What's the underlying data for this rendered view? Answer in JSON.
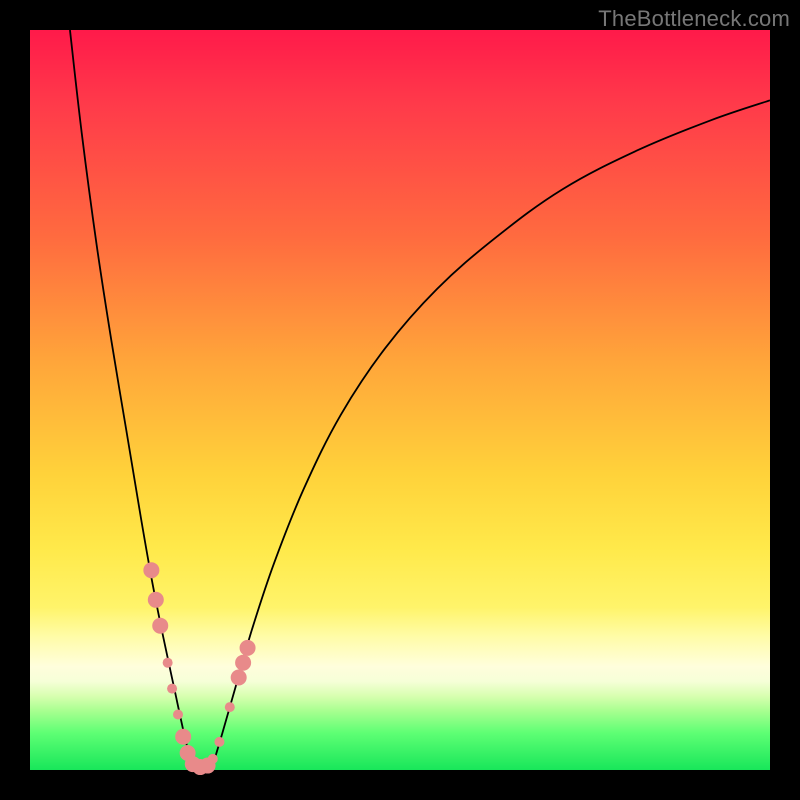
{
  "watermark": "TheBottleneck.com",
  "chart_data": {
    "type": "line",
    "title": "",
    "xlabel": "",
    "ylabel": "",
    "xlim": [
      0,
      100
    ],
    "ylim": [
      0,
      100
    ],
    "grid": false,
    "legend": false,
    "gradient_stops": [
      {
        "pos": 0,
        "color": "#ff1a4a"
      },
      {
        "pos": 10,
        "color": "#ff3a4a"
      },
      {
        "pos": 28,
        "color": "#ff6b3f"
      },
      {
        "pos": 45,
        "color": "#ffa63a"
      },
      {
        "pos": 60,
        "color": "#ffd23a"
      },
      {
        "pos": 70,
        "color": "#ffe94a"
      },
      {
        "pos": 78,
        "color": "#fff46a"
      },
      {
        "pos": 82,
        "color": "#fffca8"
      },
      {
        "pos": 86,
        "color": "#fffedc"
      },
      {
        "pos": 88,
        "color": "#f6ffd8"
      },
      {
        "pos": 90,
        "color": "#d8ffb0"
      },
      {
        "pos": 92,
        "color": "#a8ff90"
      },
      {
        "pos": 95,
        "color": "#5eff74"
      },
      {
        "pos": 100,
        "color": "#18e65a"
      }
    ],
    "series": [
      {
        "name": "left-branch",
        "x": [
          5.4,
          7,
          9,
          11,
          13,
          15,
          16.5,
          18,
          19.5,
          20.8,
          22
        ],
        "y": [
          100,
          86,
          71,
          58,
          46,
          34,
          25.5,
          18,
          11,
          5,
          0
        ],
        "stroke": "#000000",
        "stroke_width": 1.8
      },
      {
        "name": "right-branch",
        "x": [
          24.5,
          26,
          28,
          30,
          33,
          37,
          42,
          48,
          55,
          63,
          72,
          82,
          92,
          100
        ],
        "y": [
          0,
          5,
          12,
          19,
          28,
          38,
          48,
          57,
          65,
          72,
          78.5,
          83.7,
          87.8,
          90.5
        ],
        "stroke": "#000000",
        "stroke_width": 1.8
      }
    ],
    "markers": {
      "name": "pink-dots",
      "color": "#e88a8a",
      "radius_small": 5,
      "radius_large": 8,
      "points": [
        {
          "x": 16.4,
          "y": 27,
          "r": 8
        },
        {
          "x": 17.0,
          "y": 23,
          "r": 8
        },
        {
          "x": 17.6,
          "y": 19.5,
          "r": 8
        },
        {
          "x": 18.6,
          "y": 14.5,
          "r": 5
        },
        {
          "x": 19.2,
          "y": 11,
          "r": 5
        },
        {
          "x": 20.0,
          "y": 7.5,
          "r": 5
        },
        {
          "x": 20.7,
          "y": 4.5,
          "r": 8
        },
        {
          "x": 21.3,
          "y": 2.3,
          "r": 8
        },
        {
          "x": 22.0,
          "y": 0.8,
          "r": 8
        },
        {
          "x": 23.0,
          "y": 0.4,
          "r": 8
        },
        {
          "x": 24.0,
          "y": 0.6,
          "r": 8
        },
        {
          "x": 24.7,
          "y": 1.5,
          "r": 5
        },
        {
          "x": 25.6,
          "y": 3.8,
          "r": 5
        },
        {
          "x": 27.0,
          "y": 8.5,
          "r": 5
        },
        {
          "x": 28.2,
          "y": 12.5,
          "r": 8
        },
        {
          "x": 28.8,
          "y": 14.5,
          "r": 8
        },
        {
          "x": 29.4,
          "y": 16.5,
          "r": 8
        }
      ]
    }
  }
}
